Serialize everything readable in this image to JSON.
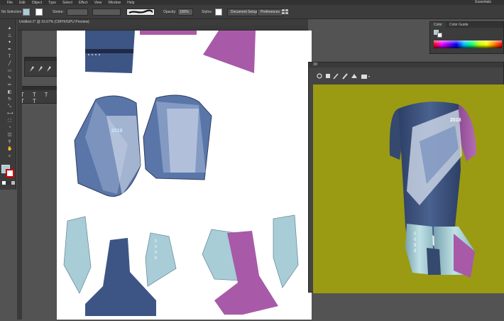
{
  "menubar": {
    "items": [
      "File",
      "Edit",
      "Object",
      "Type",
      "Select",
      "Effect",
      "View",
      "Window",
      "Help"
    ],
    "workspace": "Essentials"
  },
  "controlbar": {
    "selection_label": "No Selection",
    "stroke_label": "Stroke:",
    "opacity_label": "Opacity:",
    "opacity_value": "100%",
    "styles_label": "Styles:",
    "document_setup": "Document Setup",
    "preferences": "Preferences"
  },
  "document": {
    "tab_label": "Untitled-1* @ 16.67% (CMYK/GPU Preview)"
  },
  "panels": {
    "color": {
      "tabs": [
        "Color",
        "Color Guide"
      ]
    },
    "window3d": {
      "title": "3D"
    }
  },
  "garment": {
    "print_text": "2018",
    "number_digits": [
      "0",
      "0",
      "9",
      "8"
    ]
  },
  "colors": {
    "navy": "#3d5585",
    "purple": "#a85aa8",
    "light_blue": "#a8cdd6",
    "background_3d": "#9a9b12",
    "ui_dark": "#3c3c3c"
  }
}
